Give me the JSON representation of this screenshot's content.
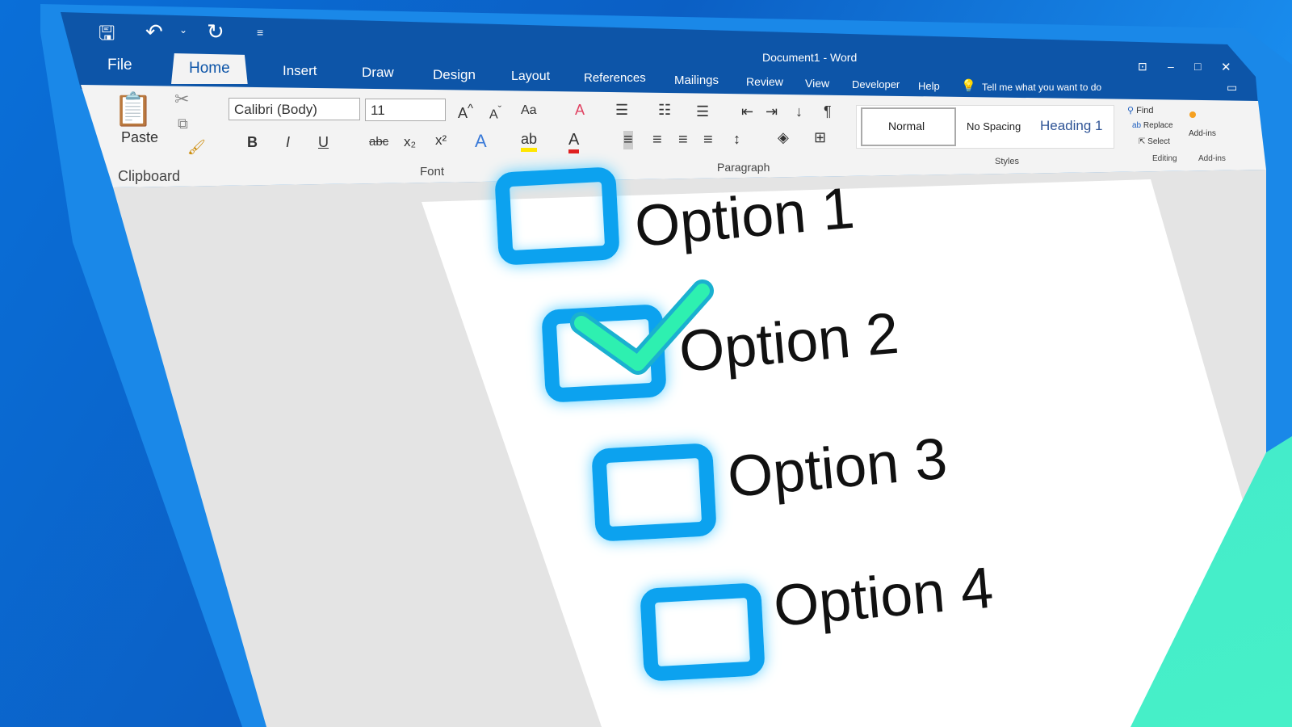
{
  "title": "Document1 - Word",
  "qat": {
    "save": "save-icon",
    "undo": "undo-icon",
    "redo": "redo-icon",
    "customize": "customize-icon"
  },
  "tabs": [
    "File",
    "Home",
    "Insert",
    "Draw",
    "Design",
    "Layout",
    "References",
    "Mailings",
    "Review",
    "View",
    "Developer",
    "Help"
  ],
  "tell_me": "Tell me what you want to do",
  "clipboard": {
    "paste": "Paste",
    "label": "Clipboard"
  },
  "font": {
    "name": "Calibri (Body)",
    "size": "11",
    "bold": "B",
    "italic": "I",
    "underline": "U",
    "strike": "abc",
    "sub": "x₂",
    "sup": "x²",
    "case": "Aa",
    "label": "Font"
  },
  "paragraph": {
    "label": "Paragraph"
  },
  "styles": {
    "items": [
      "Normal",
      "No Spacing",
      "Heading 1"
    ],
    "label": "Styles"
  },
  "editing": {
    "find": "Find",
    "replace": "Replace",
    "select": "Select",
    "label": "Editing"
  },
  "addins": {
    "button": "Add-ins",
    "label": "Add-ins"
  },
  "options": [
    {
      "label": "Option 1",
      "checked": false
    },
    {
      "label": "Option 2",
      "checked": true
    },
    {
      "label": "Option 3",
      "checked": false
    },
    {
      "label": "Option 4",
      "checked": false
    }
  ],
  "colors": {
    "accent": "#0d55a8",
    "checkbox": "#0ca2ef",
    "check": "#2ef0b0"
  }
}
